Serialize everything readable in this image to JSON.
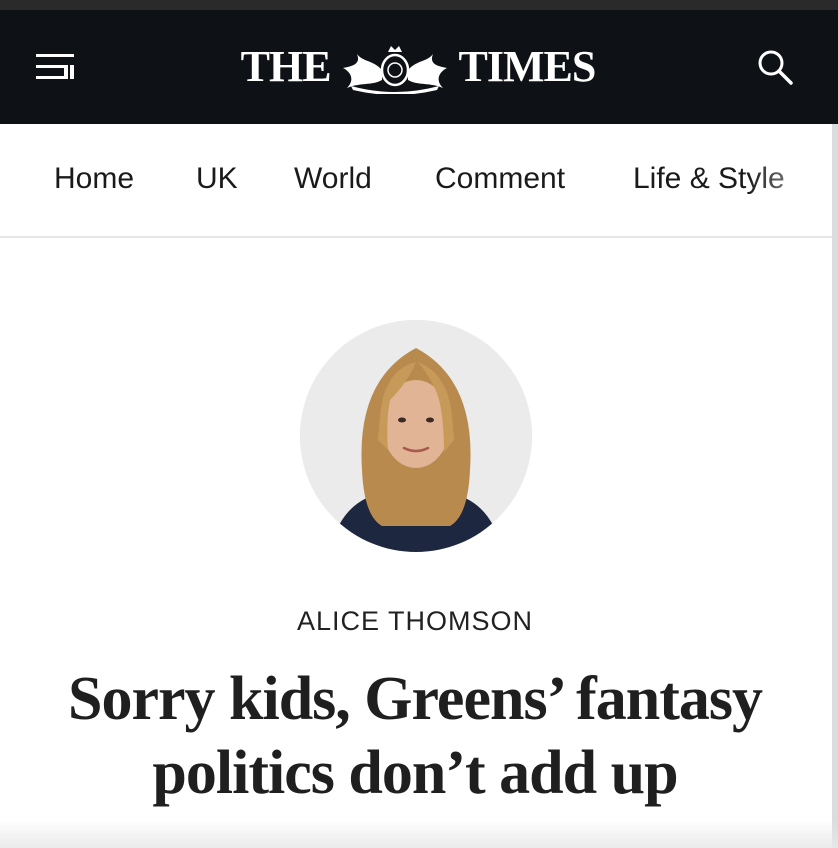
{
  "header": {
    "masthead_left": "THE",
    "masthead_right": "TIMES",
    "menu_icon": "menu-icon",
    "search_icon": "search-icon",
    "background_color": "#0e1116"
  },
  "nav": {
    "items": [
      {
        "label": "Home"
      },
      {
        "label": "UK"
      },
      {
        "label": "World"
      },
      {
        "label": "Comment"
      },
      {
        "label": "Life & Style"
      }
    ]
  },
  "article": {
    "author": "ALICE THOMSON",
    "headline_line1": "Sorry kids, Greens’ fantasy",
    "headline_line2": "politics don’t add up"
  }
}
